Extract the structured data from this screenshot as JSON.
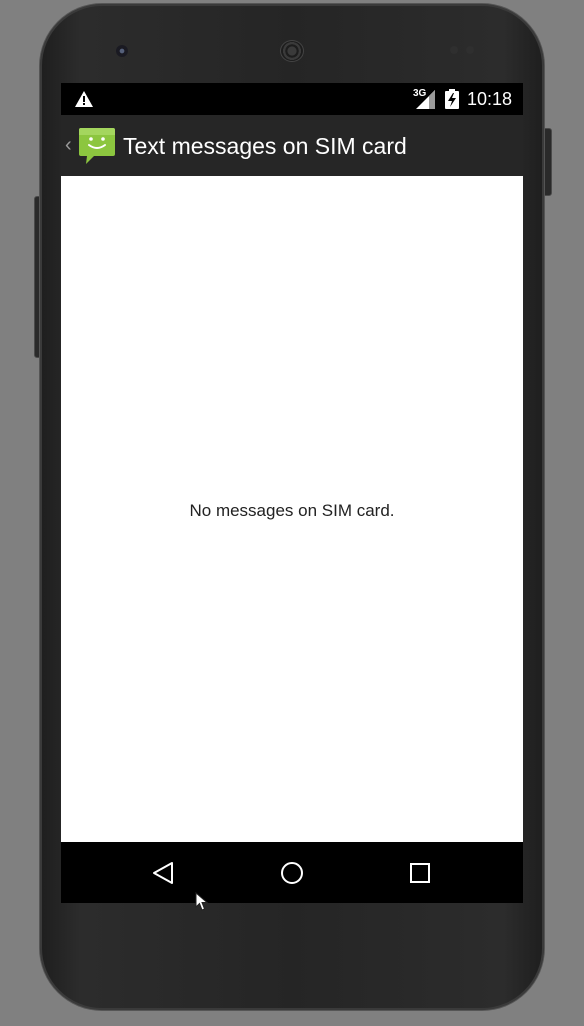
{
  "status_bar": {
    "network_type": "3G",
    "time": "10:18",
    "icons": [
      "warning-icon",
      "signal-icon",
      "battery-icon"
    ]
  },
  "action_bar": {
    "title": "Text messages on SIM card",
    "icons": [
      "up-arrow-icon",
      "messaging-app-icon"
    ]
  },
  "content": {
    "empty_message": "No messages on SIM card."
  },
  "nav_bar": {
    "buttons": [
      "back",
      "home",
      "recents"
    ]
  },
  "colors": {
    "status_bar": "#000000",
    "action_bar": "#262626",
    "app_icon_green": "#8cc63f",
    "content_bg": "#ffffff",
    "device_bg": "#808080"
  }
}
